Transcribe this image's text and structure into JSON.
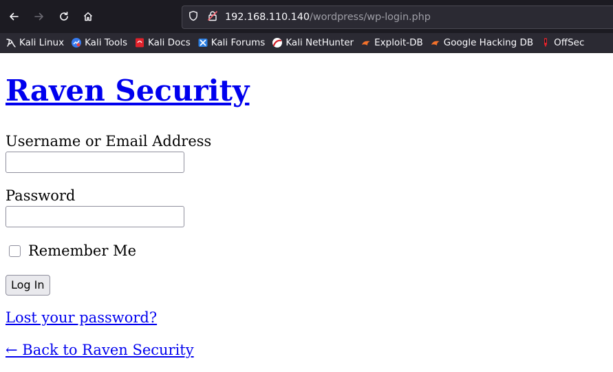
{
  "browser": {
    "url_host": "192.168.110.140",
    "url_path": "/wordpress/wp-login.php",
    "bookmarks": [
      {
        "label": "Kali Linux",
        "icon": "kali-dragon-icon"
      },
      {
        "label": "Kali Tools",
        "icon": "kali-tools-icon"
      },
      {
        "label": "Kali Docs",
        "icon": "kali-docs-icon"
      },
      {
        "label": "Kali Forums",
        "icon": "kali-forums-icon"
      },
      {
        "label": "Kali NetHunter",
        "icon": "kali-nethunter-icon"
      },
      {
        "label": "Exploit-DB",
        "icon": "exploit-db-icon"
      },
      {
        "label": "Google Hacking DB",
        "icon": "exploit-db-icon"
      },
      {
        "label": "OffSec",
        "icon": "offsec-icon"
      }
    ]
  },
  "page": {
    "site_title": "Raven Security",
    "username_label": "Username or Email Address",
    "username_value": "",
    "password_label": "Password",
    "password_value": "",
    "remember_label": "Remember Me",
    "login_button": "Log In",
    "lost_password_link": "Lost your password?",
    "back_link": "← Back to Raven Security"
  },
  "colors": {
    "link": "#0000ee",
    "toolbar_bg": "#1c1b22",
    "urlbar_bg": "#2b2a33"
  }
}
